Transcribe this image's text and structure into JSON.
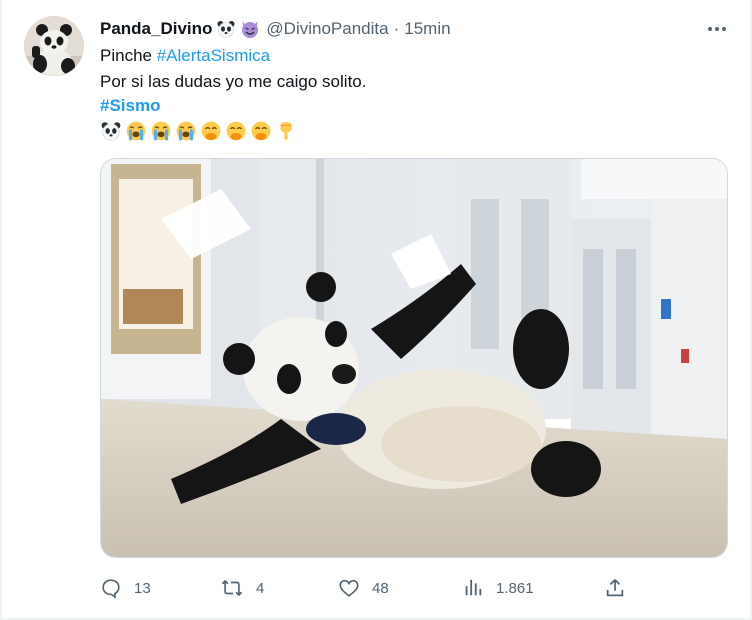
{
  "author": {
    "display_name": "Panda_Divino",
    "badges": [
      "panda-face-icon",
      "smiling-devil-icon"
    ],
    "handle": "@DivinoPandita",
    "separator": "·",
    "time": "15min"
  },
  "tweet": {
    "line1_prefix": "Pinche",
    "line1_hashtag": "#AlertaSismica",
    "line2": "Por si las dudas yo me caigo solito.",
    "line3_hashtag": "#Sismo",
    "emojis": [
      "panda-face-icon",
      "loudly-crying-face-icon",
      "loudly-crying-face-icon",
      "loudly-crying-face-icon",
      "face-with-hand-over-mouth-icon",
      "face-with-hand-over-mouth-icon",
      "face-with-hand-over-mouth-icon",
      "backhand-pointing-down-icon"
    ]
  },
  "media": {
    "alt": "panda mascot costume lying on a hallway floor holding a sheet of paper",
    "icon": "photo-panda-costume"
  },
  "actions": {
    "replies": "13",
    "retweets": "4",
    "likes": "48",
    "views": "1.861"
  },
  "colors": {
    "link": "#1d9bf0",
    "secondary_text": "#536471",
    "primary_text": "#0f1419",
    "border": "#cfd9de"
  }
}
